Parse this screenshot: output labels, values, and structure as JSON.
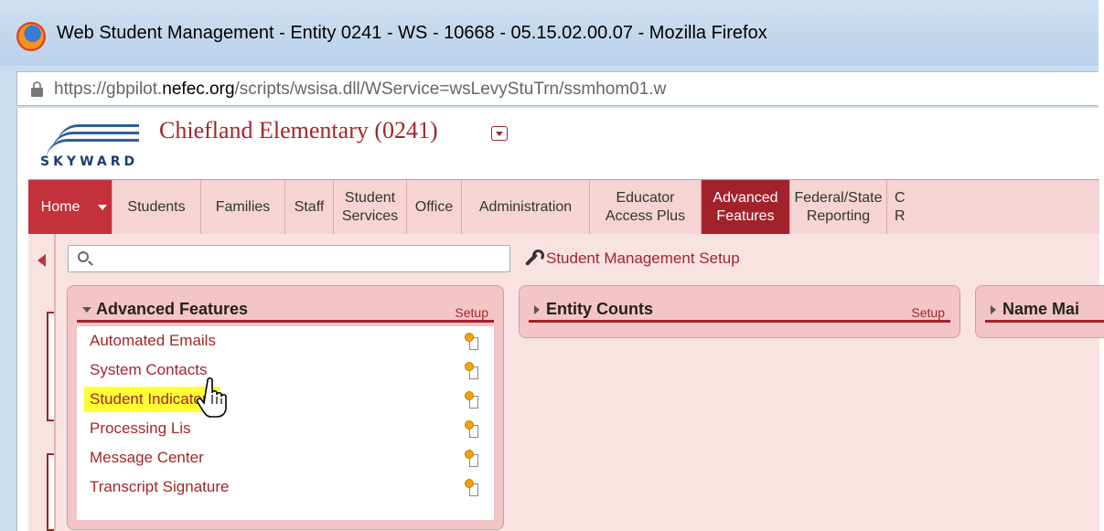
{
  "window": {
    "title": "Web Student Management - Entity 0241 - WS - 10668 - 05.15.02.00.07 - Mozilla Firefox",
    "url_prefix": "https://gbpilot.",
    "url_domain": "nefec.org",
    "url_suffix": "/scripts/wsisa.dll/WService=wsLevyStuTrn/ssmhom01.w"
  },
  "header": {
    "logo_text": "SKYWARD",
    "school": "Chiefland Elementary (0241)"
  },
  "nav": {
    "items": [
      {
        "label": "Home"
      },
      {
        "label": "Students"
      },
      {
        "label": "Families"
      },
      {
        "label": "Staff"
      },
      {
        "label": "Student Services"
      },
      {
        "label": "Office"
      },
      {
        "label": "Administration"
      },
      {
        "label": "Educator Access Plus"
      },
      {
        "label": "Advanced Features"
      },
      {
        "label": "Federal/State Reporting"
      },
      {
        "label": "C R"
      }
    ]
  },
  "toolbar": {
    "search_placeholder": "",
    "setup_link": "Student Management Setup"
  },
  "panels": {
    "advanced": {
      "title": "Advanced Features",
      "setup": "Setup",
      "items": [
        "Automated Emails",
        "System Contacts",
        "Student Indicators",
        "Processing Lis",
        "Message Center",
        "Transcript Signature"
      ]
    },
    "entity": {
      "title": "Entity Counts",
      "setup": "Setup"
    },
    "name": {
      "title": "Name Mai"
    }
  },
  "colors": {
    "accent": "#a2222c",
    "highlight": "#ffff33"
  }
}
